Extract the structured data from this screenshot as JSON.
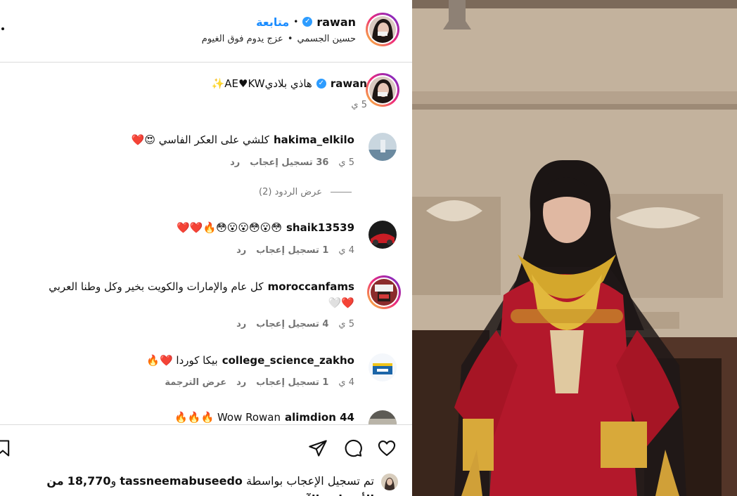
{
  "header": {
    "username": "rawan",
    "separator": "•",
    "follow_label": "متابعة",
    "audio_artist": "حسين الجسمي",
    "audio_separator": "•",
    "audio_title": "عزج يدوم فوق الغيوم"
  },
  "caption": {
    "username": "rawan",
    "text": "هاذي بلاديAE♥KW✨",
    "time": "5 ي"
  },
  "comments": [
    {
      "username": "hakima_elkilo",
      "text": "كلشي على العكر الفاسي 😍❤️",
      "time": "5 ي",
      "likes": "36 تسجيل إعجاب",
      "reply": "رد"
    },
    {
      "username": "shaik13539",
      "text": "😳😮😳😮😮😳🔥❤️❤️",
      "time": "4 ي",
      "likes": "1 تسجيل إعجاب",
      "reply": "رد"
    },
    {
      "username": "moroccanfams",
      "text": "كل عام والإمارات والكويت بخير وكل وطنا العربي",
      "text2": "❤️🤍",
      "time": "5 ي",
      "likes": "4 تسجيل إعجاب",
      "reply": "رد"
    },
    {
      "username": "college_science_zakho",
      "text": "بيكا كوردا ❤️🔥",
      "time": "4 ي",
      "likes": "1 تسجيل إعجاب",
      "reply": "رد",
      "translate": "عرض الترجمة"
    },
    {
      "username": "alimdion 44",
      "text": "Wow Rowan 🔥🔥🔥"
    }
  ],
  "view_replies": "عرض الردود (2)",
  "likes_summary": {
    "prefix": "تم تسجيل الإعجاب بواسطة",
    "user": "tassneemabuseedo",
    "connector": "و",
    "count": "18,770",
    "suffix": "من الأشخاص الآخرين"
  },
  "icons": [
    "heart-icon",
    "comment-icon",
    "share-icon",
    "bookmark-icon",
    "verified-icon"
  ],
  "colors": {
    "link": "#1a8cff",
    "verified": "#2d9cff",
    "muted": "#737373",
    "dress": "#b3182b"
  }
}
